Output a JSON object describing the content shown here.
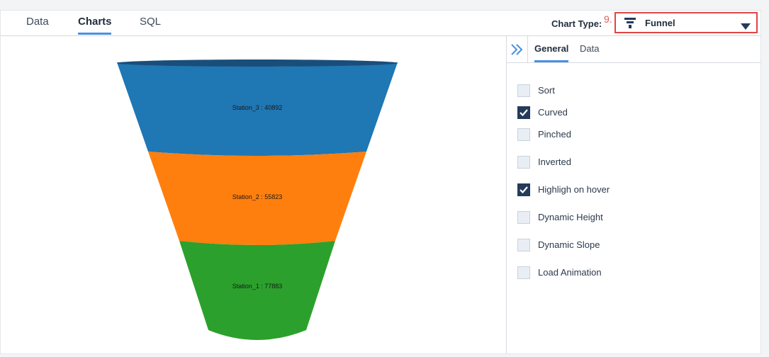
{
  "tabs": [
    {
      "label": "Data",
      "active": false
    },
    {
      "label": "Charts",
      "active": true
    },
    {
      "label": "SQL",
      "active": false
    }
  ],
  "chart_type": {
    "label": "Chart Type:",
    "annotation": "9.",
    "selected": "Funnel",
    "icon": "funnel-icon"
  },
  "side_panel": {
    "collapse_icon": "double-chevron-right-icon",
    "tabs": [
      {
        "label": "General",
        "active": true
      },
      {
        "label": "Data",
        "active": false
      }
    ],
    "options": [
      {
        "label": "Sort",
        "checked": false
      },
      {
        "label": "Curved",
        "checked": true
      },
      {
        "label": "Pinched",
        "checked": false
      },
      {
        "label": "Inverted",
        "checked": false
      },
      {
        "label": "Highligh on hover",
        "checked": true
      },
      {
        "label": "Dynamic Height",
        "checked": false
      },
      {
        "label": "Dynamic Slope",
        "checked": false
      },
      {
        "label": "Load Animation",
        "checked": false
      }
    ]
  },
  "chart_data": {
    "type": "funnel",
    "curved": true,
    "series": [
      {
        "name": "Station_3",
        "value": 40892,
        "color": "#1f77b4"
      },
      {
        "name": "Station_2",
        "value": 55823,
        "color": "#ff7f0e"
      },
      {
        "name": "Station_1",
        "value": 77883,
        "color": "#2ca02c"
      }
    ]
  }
}
